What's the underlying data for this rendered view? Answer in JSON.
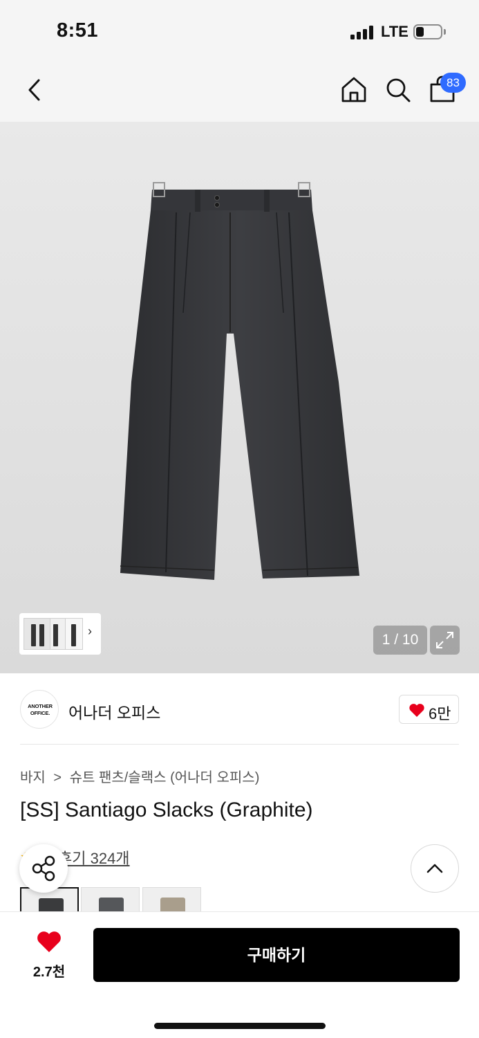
{
  "status_bar": {
    "time": "8:51",
    "network": "LTE"
  },
  "nav": {
    "back_icon": "chevron-left-icon",
    "home_icon": "home-icon",
    "search_icon": "search-icon",
    "cart_icon": "shopping-bag-icon",
    "cart_badge": "83"
  },
  "gallery": {
    "page_counter": "1 / 10",
    "expand_icon": "expand-icon",
    "thumbnail_chevron": "›"
  },
  "brand": {
    "logo_line1": "ANOTHER",
    "logo_line2": "OFFICE.",
    "name": "어나더 오피스",
    "like_count": "6만"
  },
  "product": {
    "breadcrumb": [
      "바지",
      ">",
      "슈트 팬츠/슬랙스 (어나더 오피스)"
    ],
    "title": "[SS] Santiago Slacks (Graphite)",
    "review_text": "후기 324개",
    "swatch_colors": [
      "#3a3b3d",
      "#55575a",
      "#a99e8c"
    ]
  },
  "bottom_bar": {
    "wish_count": "2.7천",
    "buy_label": "구매하기"
  },
  "colors": {
    "accent_badge": "#2f6bff",
    "heart": "#e8001c",
    "buy_button": "#000000"
  }
}
